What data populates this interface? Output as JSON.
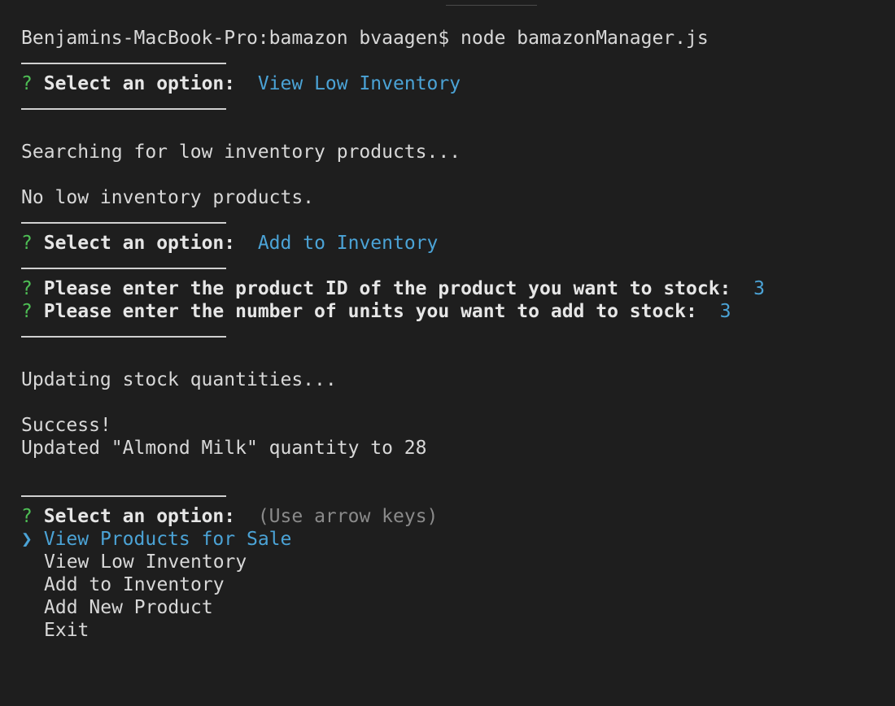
{
  "command_line": "Benjamins-MacBook-Pro:bamazon bvaagen$ node bamazonManager.js",
  "prompt_mark": "?",
  "prompt_label": "Select an option:",
  "answer_1": "View Low Inventory",
  "msg_searching": "Searching for low inventory products...",
  "msg_no_low": "No low inventory products.",
  "answer_2": "Add to Inventory",
  "q_product_id": "Please enter the product ID of the product you want to stock:",
  "a_product_id": "3",
  "q_units": "Please enter the number of units you want to add to stock:",
  "a_units": "3",
  "msg_updating": "Updating stock quantities...",
  "msg_success": "Success!",
  "msg_updated": "Updated \"Almond Milk\" quantity to 28",
  "hint": "(Use arrow keys)",
  "pointer": "❯",
  "menu": {
    "selected": "View Products for Sale",
    "item_1": "View Low Inventory",
    "item_2": "Add to Inventory",
    "item_3": "Add New Product",
    "item_4": "Exit"
  }
}
